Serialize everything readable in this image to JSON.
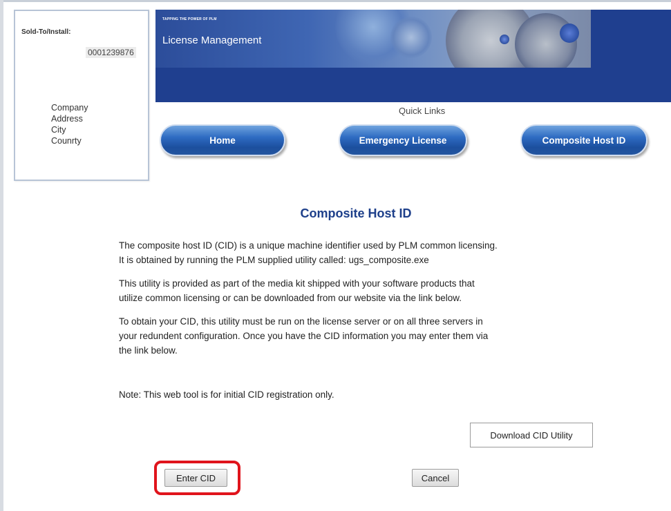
{
  "account": {
    "sold_to_label": "Sold-To/Install:",
    "sold_to_number": "0001239876",
    "address_lines": [
      "Company",
      "Address",
      "City",
      "Counrty"
    ]
  },
  "banner": {
    "tagline": "TAPPING THE POWER OF PLM",
    "title": "License Management"
  },
  "quick_links": {
    "label": "Quick Links",
    "buttons": [
      "Home",
      "Emergency License",
      "Composite Host ID"
    ]
  },
  "content": {
    "title": "Composite Host ID",
    "paragraphs": [
      [
        "The composite host ID (CID) is a unique machine identifier used by PLM common licensing.",
        "It is obtained by running the PLM supplied utility called: ugs_composite.exe"
      ],
      [
        "This utility is provided as part of the media kit shipped with your software products that",
        "utilize common licensing or can be downloaded from our website via the link below."
      ],
      [
        "To obtain your CID, this utility must be run on the license server or on all three servers in",
        "your redundent configuration. Once you have the CID information you may enter them via",
        "the link below."
      ]
    ],
    "note": "Note: This web tool is for initial CID registration only."
  },
  "actions": {
    "download_label": "Download CID Utility",
    "enter_label": "Enter CID",
    "cancel_label": "Cancel"
  },
  "colors": {
    "banner": "#1f3f8f",
    "title": "#1d3f8a",
    "highlight": "#e0141c"
  }
}
